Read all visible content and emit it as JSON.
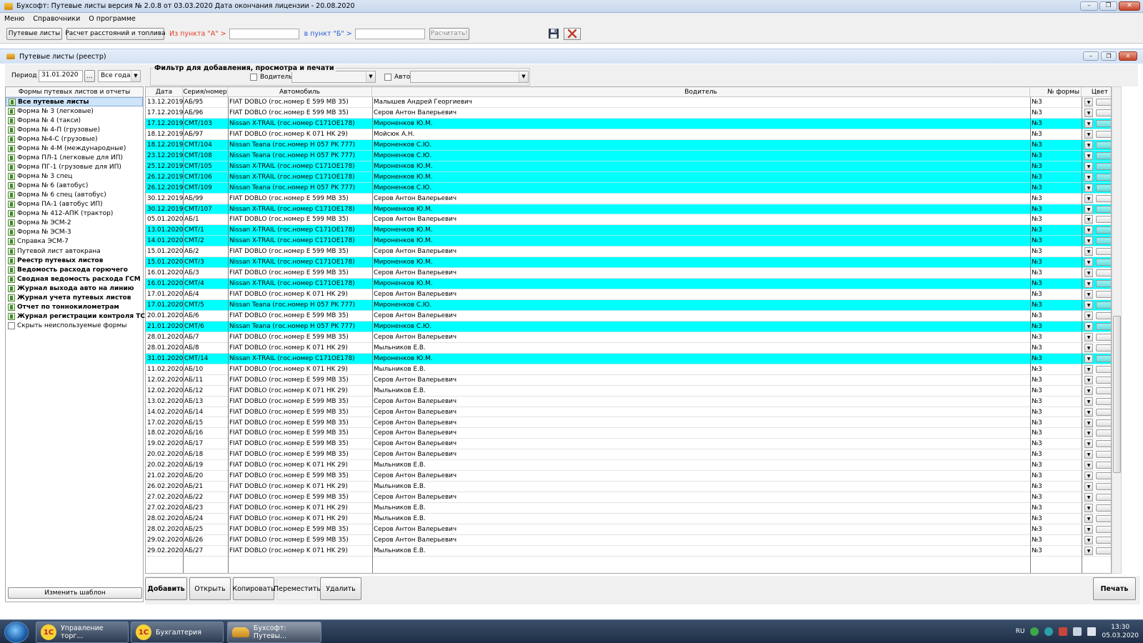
{
  "window": {
    "title": "Бухсофт: Путевые листы версия № 2.0.8 от 03.03.2020 Дата окончания лицензии - 20.08.2020",
    "min": "–",
    "max": "❐",
    "close": "✕"
  },
  "menu": [
    "Меню",
    "Справочники",
    "О программе"
  ],
  "toolbar": {
    "waybills_btn": "Путевые листы",
    "calc_btn": "Расчет расстояний и топлива",
    "from_label": "Из пункта \"А\" >",
    "to_label": "в пункт \"Б\" >",
    "from_value": "",
    "to_value": "",
    "calculate_btn": "Расчитать!",
    "save_icon": "floppy-disk-icon",
    "close_icon": "close-x-icon"
  },
  "subwindow": {
    "title": "Путевые листы (реестр)",
    "min": "–",
    "max": "❐",
    "close": "✕"
  },
  "filter": {
    "legend": "Фильтр для добавления, просмотра и печати",
    "period_label": "Период",
    "period_value": "31.01.2020",
    "period_btn": "...",
    "year_value": "Все года",
    "driver_label": "Водитель",
    "auto_label": "Авто",
    "driver_value": "",
    "auto_value": ""
  },
  "left_panel": {
    "header": "Формы путевых листов и отчеты",
    "items": [
      {
        "label": "Все путевые листы",
        "bold": true,
        "selected": true,
        "icon": "form-icon"
      },
      {
        "label": "Форма № 3 (легковые)",
        "bold": false,
        "icon": "form-icon"
      },
      {
        "label": "Форма № 4 (такси)",
        "bold": false,
        "icon": "form-icon"
      },
      {
        "label": "Форма № 4-П (грузовые)",
        "bold": false,
        "icon": "form-icon"
      },
      {
        "label": "Форма №4-С (грузовые)",
        "bold": false,
        "icon": "form-icon"
      },
      {
        "label": "Форма № 4-М (международные)",
        "bold": false,
        "icon": "form-icon"
      },
      {
        "label": "Форма ПЛ-1 (легковые для ИП)",
        "bold": false,
        "icon": "form-icon"
      },
      {
        "label": "Форма ПГ-1 (грузовые для ИП)",
        "bold": false,
        "icon": "form-icon"
      },
      {
        "label": "Форма № 3 спец",
        "bold": false,
        "icon": "form-icon"
      },
      {
        "label": "Форма № 6 (автобус)",
        "bold": false,
        "icon": "form-icon"
      },
      {
        "label": "Форма № 6 спец (автобус)",
        "bold": false,
        "icon": "form-icon"
      },
      {
        "label": "Форма ПА-1 (автобус ИП)",
        "bold": false,
        "icon": "form-icon"
      },
      {
        "label": "Форма № 412-АПК (трактор)",
        "bold": false,
        "icon": "form-icon"
      },
      {
        "label": "Форма № ЭСМ-2",
        "bold": false,
        "icon": "form-icon"
      },
      {
        "label": "Форма № ЭСМ-3",
        "bold": false,
        "icon": "form-icon"
      },
      {
        "label": "Справка ЭСМ-7",
        "bold": false,
        "icon": "form-icon"
      },
      {
        "label": "Путевой лист автокрана",
        "bold": false,
        "icon": "form-icon"
      },
      {
        "label": "Реестр путевых листов",
        "bold": true,
        "icon": "report-icon"
      },
      {
        "label": "Ведомость расхода горючего",
        "bold": true,
        "icon": "report-icon"
      },
      {
        "label": "Сводная ведомость расхода ГСМ",
        "bold": true,
        "icon": "report-icon"
      },
      {
        "label": "Журнал выхода авто на линию",
        "bold": true,
        "icon": "report-icon"
      },
      {
        "label": "Журнал учета путевых листов",
        "bold": true,
        "icon": "report-icon"
      },
      {
        "label": "Отчет по тоннокилометрам",
        "bold": true,
        "icon": "report-icon"
      },
      {
        "label": "Журнал регистрации контроля ТС",
        "bold": true,
        "icon": "report-icon"
      },
      {
        "label": "Скрыть неиспользуемые формы",
        "bold": false,
        "icon": "checkbox-icon"
      }
    ],
    "footer_btn": "Изменить шаблон"
  },
  "grid": {
    "columns": [
      "Дата",
      "Серия/номер",
      "Автомобиль",
      "Водитель",
      "№ формы",
      "Цвет"
    ],
    "rows": [
      [
        "13.12.2019",
        "АБ/95",
        "FIAT DOBLO (гос.номер E 599 MB 35)",
        "Малышев Андрей Георгиевич",
        "№3",
        false
      ],
      [
        "17.12.2019",
        "АБ/96",
        "FIAT DOBLO (гос.номер E 599 MB 35)",
        "Серов Антон Валерьевич",
        "№3",
        false
      ],
      [
        "17.12.2019",
        "СМТ/103",
        "Nissan X-TRAIL (гос.номер C171OE178)",
        "Мироненков Ю.М.",
        "№3",
        true
      ],
      [
        "18.12.2019",
        "АБ/97",
        "FIAT DOBLO (гос.номер K 071 HK 29)",
        "Мойсюк А.Н.",
        "№3",
        false
      ],
      [
        "18.12.2019",
        "СМТ/104",
        "Nissan Teana (гос.номер H 057 PK 777)",
        "Мироненков С.Ю.",
        "№3",
        true
      ],
      [
        "23.12.2019",
        "СМТ/108",
        "Nissan Teana (гос.номер H 057 PK 777)",
        "Мироненков С.Ю.",
        "№3",
        true
      ],
      [
        "25.12.2019",
        "СМТ/105",
        "Nissan X-TRAIL (гос.номер C171OE178)",
        "Мироненков Ю.М.",
        "№3",
        true
      ],
      [
        "26.12.2019",
        "СМТ/106",
        "Nissan X-TRAIL (гос.номер C171OE178)",
        "Мироненков Ю.М.",
        "№3",
        true
      ],
      [
        "26.12.2019",
        "СМТ/109",
        "Nissan Teana (гос.номер H 057 PK 777)",
        "Мироненков С.Ю.",
        "№3",
        true
      ],
      [
        "30.12.2019",
        "АБ/99",
        "FIAT DOBLO (гос.номер E 599 MB 35)",
        "Серов Антон Валерьевич",
        "№3",
        false
      ],
      [
        "30.12.2019",
        "СМТ/107",
        "Nissan X-TRAIL (гос.номер C171OE178)",
        "Мироненков Ю.М.",
        "№3",
        true
      ],
      [
        "05.01.2020",
        "АБ/1",
        "FIAT DOBLO (гос.номер E 599 MB 35)",
        "Серов Антон Валерьевич",
        "№3",
        false
      ],
      [
        "13.01.2020",
        "СМТ/1",
        "Nissan X-TRAIL (гос.номер C171OE178)",
        "Мироненков Ю.М.",
        "№3",
        true
      ],
      [
        "14.01.2020",
        "СМТ/2",
        "Nissan X-TRAIL (гос.номер C171OE178)",
        "Мироненков Ю.М.",
        "№3",
        true
      ],
      [
        "15.01.2020",
        "АБ/2",
        "FIAT DOBLO (гос.номер E 599 MB 35)",
        "Серов Антон Валерьевич",
        "№3",
        false
      ],
      [
        "15.01.2020",
        "СМТ/3",
        "Nissan X-TRAIL (гос.номер C171OE178)",
        "Мироненков Ю.М.",
        "№3",
        true
      ],
      [
        "16.01.2020",
        "АБ/3",
        "FIAT DOBLO (гос.номер E 599 MB 35)",
        "Серов Антон Валерьевич",
        "№3",
        false
      ],
      [
        "16.01.2020",
        "СМТ/4",
        "Nissan X-TRAIL (гос.номер C171OE178)",
        "Мироненков Ю.М.",
        "№3",
        true
      ],
      [
        "17.01.2020",
        "АБ/4",
        "FIAT DOBLO (гос.номер K 071 HK 29)",
        "Серов Антон Валерьевич",
        "№3",
        false
      ],
      [
        "17.01.2020",
        "СМТ/5",
        "Nissan Teana (гос.номер H 057 PK 777)",
        "Мироненков С.Ю.",
        "№3",
        true
      ],
      [
        "20.01.2020",
        "АБ/6",
        "FIAT DOBLO (гос.номер E 599 MB 35)",
        "Серов Антон Валерьевич",
        "№3",
        false
      ],
      [
        "21.01.2020",
        "СМТ/6",
        "Nissan Teana (гос.номер H 057 PK 777)",
        "Мироненков С.Ю.",
        "№3",
        true
      ],
      [
        "28.01.2020",
        "АБ/7",
        "FIAT DOBLO (гос.номер E 599 MB 35)",
        "Серов Антон Валерьевич",
        "№3",
        false
      ],
      [
        "28.01.2020",
        "АБ/8",
        "FIAT DOBLO (гос.номер K 071 HK 29)",
        "Мыльников Е.В.",
        "№3",
        false
      ],
      [
        "31.01.2020",
        "СМТ/14",
        "Nissan X-TRAIL (гос.номер C171OE178)",
        "Мироненков Ю.М.",
        "№3",
        true
      ],
      [
        "11.02.2020",
        "АБ/10",
        "FIAT DOBLO (гос.номер K 071 HK 29)",
        "Мыльников Е.В.",
        "№3",
        false
      ],
      [
        "12.02.2020",
        "АБ/11",
        "FIAT DOBLO (гос.номер E 599 MB 35)",
        "Серов Антон Валерьевич",
        "№3",
        false
      ],
      [
        "12.02.2020",
        "АБ/12",
        "FIAT DOBLO (гос.номер K 071 HK 29)",
        "Мыльников Е.В.",
        "№3",
        false
      ],
      [
        "13.02.2020",
        "АБ/13",
        "FIAT DOBLO (гос.номер E 599 MB 35)",
        "Серов Антон Валерьевич",
        "№3",
        false
      ],
      [
        "14.02.2020",
        "АБ/14",
        "FIAT DOBLO (гос.номер E 599 MB 35)",
        "Серов Антон Валерьевич",
        "№3",
        false
      ],
      [
        "17.02.2020",
        "АБ/15",
        "FIAT DOBLO (гос.номер E 599 MB 35)",
        "Серов Антон Валерьевич",
        "№3",
        false
      ],
      [
        "18.02.2020",
        "АБ/16",
        "FIAT DOBLO (гос.номер E 599 MB 35)",
        "Серов Антон Валерьевич",
        "№3",
        false
      ],
      [
        "19.02.2020",
        "АБ/17",
        "FIAT DOBLO (гос.номер E 599 MB 35)",
        "Серов Антон Валерьевич",
        "№3",
        false
      ],
      [
        "20.02.2020",
        "АБ/18",
        "FIAT DOBLO (гос.номер E 599 MB 35)",
        "Серов Антон Валерьевич",
        "№3",
        false
      ],
      [
        "20.02.2020",
        "АБ/19",
        "FIAT DOBLO (гос.номер K 071 HK 29)",
        "Мыльников Е.В.",
        "№3",
        false
      ],
      [
        "21.02.2020",
        "АБ/20",
        "FIAT DOBLO (гос.номер E 599 MB 35)",
        "Серов Антон Валерьевич",
        "№3",
        false
      ],
      [
        "26.02.2020",
        "АБ/21",
        "FIAT DOBLO (гос.номер K 071 HK 29)",
        "Мыльников Е.В.",
        "№3",
        false
      ],
      [
        "27.02.2020",
        "АБ/22",
        "FIAT DOBLO (гос.номер E 599 MB 35)",
        "Серов Антон Валерьевич",
        "№3",
        false
      ],
      [
        "27.02.2020",
        "АБ/23",
        "FIAT DOBLO (гос.номер K 071 HK 29)",
        "Мыльников Е.В.",
        "№3",
        false
      ],
      [
        "28.02.2020",
        "АБ/24",
        "FIAT DOBLO (гос.номер K 071 HK 29)",
        "Мыльников Е.В.",
        "№3",
        false
      ],
      [
        "28.02.2020",
        "АБ/25",
        "FIAT DOBLO (гос.номер E 599 MB 35)",
        "Серов Антон Валерьевич",
        "№3",
        false
      ],
      [
        "29.02.2020",
        "АБ/26",
        "FIAT DOBLO (гос.номер E 599 MB 35)",
        "Серов Антон Валерьевич",
        "№3",
        false
      ],
      [
        "29.02.2020",
        "АБ/27",
        "FIAT DOBLO (гос.номер K 071 HK 29)",
        "Мыльников Е.В.",
        "№3",
        false
      ]
    ]
  },
  "bottom": {
    "add": "Добавить",
    "open": "Открыть",
    "copy": "Копировать",
    "move": "Переместить",
    "delete": "Удалить",
    "print": "Печать"
  },
  "taskbar": {
    "tasks": [
      {
        "label": "Управление торг...",
        "icon": "1c-icon"
      },
      {
        "label": "Бухгалтерия",
        "icon": "1c-icon"
      },
      {
        "label": "Бухсофт: Путевы...",
        "icon": "car-icon",
        "active": true
      }
    ],
    "lang": "RU",
    "time": "13:30",
    "date": "05.03.2020",
    "one_c_glyph": "1С"
  },
  "colors": {
    "highlight": "#00ffff",
    "red_label": "#e23c28",
    "blue_label": "#2a5bd7"
  }
}
